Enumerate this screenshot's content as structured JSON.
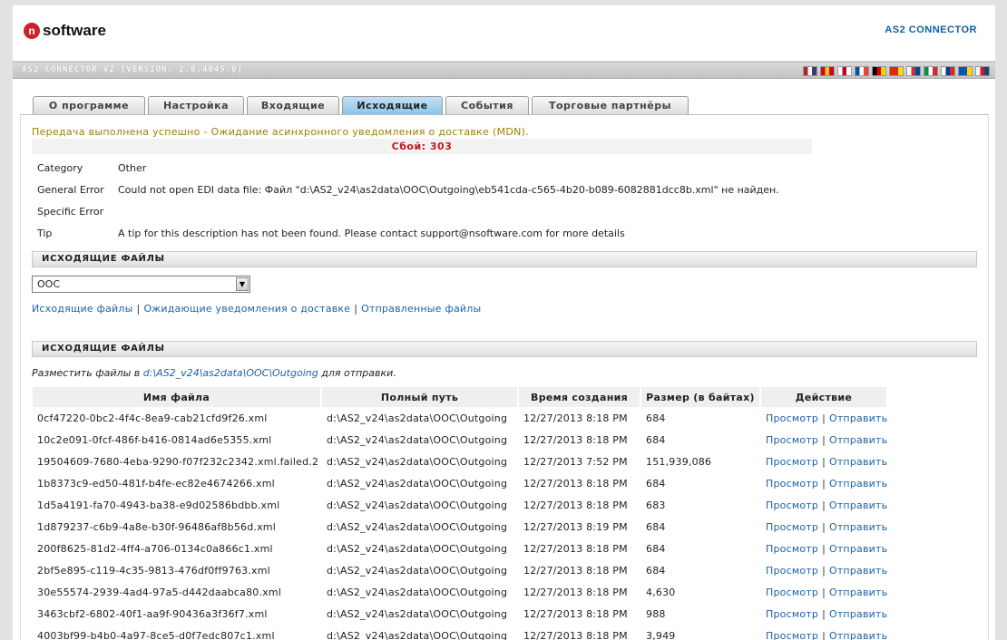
{
  "header": {
    "logo_mark": "n",
    "logo_text": "software",
    "product": "AS2 CONNECTOR"
  },
  "version_bar": {
    "version": "AS2 CONNECTOR V2 [VERSION: 2.0.4045.0]",
    "flags": [
      {
        "name": "us-flag",
        "colors": [
          "#b22234",
          "#fff",
          "#3c3b6e"
        ]
      },
      {
        "name": "es-flag",
        "colors": [
          "#c60b1e",
          "#ffc400",
          "#c60b1e"
        ]
      },
      {
        "name": "jp-flag",
        "colors": [
          "#fff",
          "#bc002d",
          "#fff"
        ]
      },
      {
        "name": "fr-flag",
        "colors": [
          "#0055a4",
          "#fff",
          "#ef4135"
        ]
      },
      {
        "name": "de-flag",
        "colors": [
          "#000",
          "#dd0000",
          "#ffce00"
        ]
      },
      {
        "name": "cn-flag",
        "colors": [
          "#de2910",
          "#de2910",
          "#ffde00"
        ]
      },
      {
        "name": "kr-flag",
        "colors": [
          "#fff",
          "#cd2e3a",
          "#0047a0"
        ]
      },
      {
        "name": "it-flag",
        "colors": [
          "#009246",
          "#fff",
          "#ce2b37"
        ]
      },
      {
        "name": "ru-flag",
        "colors": [
          "#fff",
          "#0039a6",
          "#d52b1e"
        ]
      },
      {
        "name": "ua-flag",
        "colors": [
          "#0057b7",
          "#0057b7",
          "#ffd700"
        ]
      },
      {
        "name": "cz-flag",
        "colors": [
          "#fff",
          "#d7141a",
          "#11457e"
        ]
      }
    ]
  },
  "tabs": [
    {
      "label": "О программе",
      "active": false
    },
    {
      "label": "Настройка",
      "active": false
    },
    {
      "label": "Входящие",
      "active": false
    },
    {
      "label": "Исходящие",
      "active": true
    },
    {
      "label": "События",
      "active": false
    },
    {
      "label": "Торговые партнёры",
      "active": false
    }
  ],
  "status": {
    "message": "Передача выполнена успешно - Ожидание асинхронного уведомления о доставке (MDN).",
    "error_title": "Сбой: 303"
  },
  "error_details": [
    {
      "label": "Category",
      "value": "Other"
    },
    {
      "label": "General Error",
      "value": "Could not open EDI data file: Файл \"d:\\AS2_v24\\as2data\\OOC\\Outgoing\\eb541cda-c565-4b20-b089-6082881dcc8b.xml\" не найден."
    },
    {
      "label": "Specific Error",
      "value": ""
    },
    {
      "label": "Tip",
      "value": "A tip for this description has not been found. Please contact support@nsoftware.com for more details"
    }
  ],
  "section1": {
    "title": "ИСХОДЯЩИЕ ФАЙЛЫ",
    "select_value": "OOC",
    "links": [
      "Исходящие файлы",
      "Ожидающие уведомления о доставке",
      "Отправленные файлы"
    ],
    "separator": "|"
  },
  "section2": {
    "title": "ИСХОДЯЩИЕ ФАЙЛЫ",
    "place_prefix": "Разместить файлы в",
    "place_path": "d:\\AS2_v24\\as2data\\OOC\\Outgoing",
    "place_suffix": "для отправки."
  },
  "table": {
    "columns": [
      "Имя файла",
      "Полный путь",
      "Время создания",
      "Размер (в байтах)",
      "Действие"
    ],
    "view_label": "Просмотр",
    "send_label": "Отправить",
    "separator": "|",
    "rows": [
      {
        "name": "0cf47220-0bc2-4f4c-8ea9-cab21cfd9f26.xml",
        "path": "d:\\AS2_v24\\as2data\\OOC\\Outgoing",
        "time": "12/27/2013 8:18 PM",
        "size": "684"
      },
      {
        "name": "10c2e091-0fcf-486f-b416-0814ad6e5355.xml",
        "path": "d:\\AS2_v24\\as2data\\OOC\\Outgoing",
        "time": "12/27/2013 8:18 PM",
        "size": "684"
      },
      {
        "name": "19504609-7680-4eba-9290-f07f232c2342.xml.failed.2",
        "path": "d:\\AS2_v24\\as2data\\OOC\\Outgoing",
        "time": "12/27/2013 7:52 PM",
        "size": "151,939,086"
      },
      {
        "name": "1b8373c9-ed50-481f-b4fe-ec82e4674266.xml",
        "path": "d:\\AS2_v24\\as2data\\OOC\\Outgoing",
        "time": "12/27/2013 8:18 PM",
        "size": "684"
      },
      {
        "name": "1d5a4191-fa70-4943-ba38-e9d02586bdbb.xml",
        "path": "d:\\AS2_v24\\as2data\\OOC\\Outgoing",
        "time": "12/27/2013 8:18 PM",
        "size": "683"
      },
      {
        "name": "1d879237-c6b9-4a8e-b30f-96486af8b56d.xml",
        "path": "d:\\AS2_v24\\as2data\\OOC\\Outgoing",
        "time": "12/27/2013 8:19 PM",
        "size": "684"
      },
      {
        "name": "200f8625-81d2-4ff4-a706-0134c0a866c1.xml",
        "path": "d:\\AS2_v24\\as2data\\OOC\\Outgoing",
        "time": "12/27/2013 8:18 PM",
        "size": "684"
      },
      {
        "name": "2bf5e895-c119-4c35-9813-476df0ff9763.xml",
        "path": "d:\\AS2_v24\\as2data\\OOC\\Outgoing",
        "time": "12/27/2013 8:18 PM",
        "size": "684"
      },
      {
        "name": "30e55574-2939-4ad4-97a5-d442daabca80.xml",
        "path": "d:\\AS2_v24\\as2data\\OOC\\Outgoing",
        "time": "12/27/2013 8:18 PM",
        "size": "4,630"
      },
      {
        "name": "3463cbf2-6802-40f1-aa9f-90436a3f36f7.xml",
        "path": "d:\\AS2_v24\\as2data\\OOC\\Outgoing",
        "time": "12/27/2013 8:18 PM",
        "size": "988"
      },
      {
        "name": "4003bf99-b4b0-4a97-8ce5-d0f7edc807c1.xml",
        "path": "d:\\AS2_v24\\as2data\\OOC\\Outgoing",
        "time": "12/27/2013 8:18 PM",
        "size": "3,949"
      }
    ]
  }
}
